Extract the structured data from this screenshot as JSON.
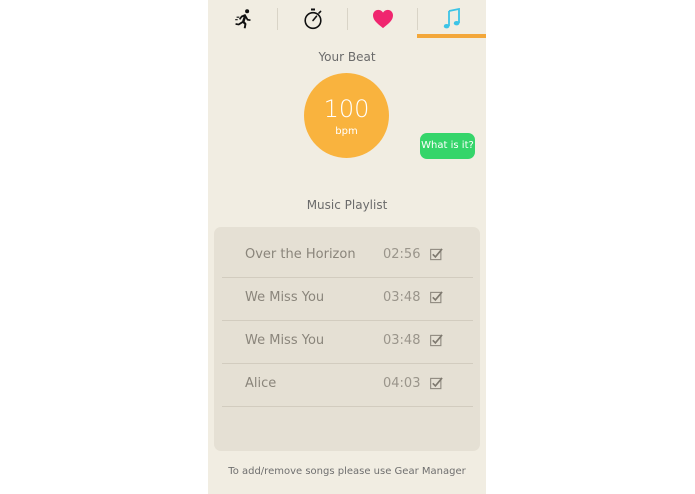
{
  "tabs": [
    {
      "icon": "running-person-icon",
      "selected": false
    },
    {
      "icon": "stopwatch-icon",
      "selected": false
    },
    {
      "icon": "heart-icon",
      "selected": false,
      "color": "#f0266f"
    },
    {
      "icon": "music-note-icon",
      "selected": true,
      "color": "#3cc4e6"
    }
  ],
  "colors": {
    "accent_orange": "#f3a73a",
    "bpm_circle": "#f9b33e",
    "action_green": "#35d56a",
    "background": "#f1ede2"
  },
  "beat": {
    "title": "Your Beat",
    "value": "100",
    "unit": "bpm",
    "help_button": "What is it?"
  },
  "playlist": {
    "title": "Music Playlist",
    "songs": [
      {
        "title": "Over the Horizon",
        "duration": "02:56",
        "checked": true
      },
      {
        "title": "We Miss You",
        "duration": "03:48",
        "checked": true
      },
      {
        "title": "We Miss You",
        "duration": "03:48",
        "checked": true
      },
      {
        "title": "Alice",
        "duration": "04:03",
        "checked": true
      }
    ]
  },
  "footer": {
    "note": "To add/remove songs please use Gear Manager"
  }
}
